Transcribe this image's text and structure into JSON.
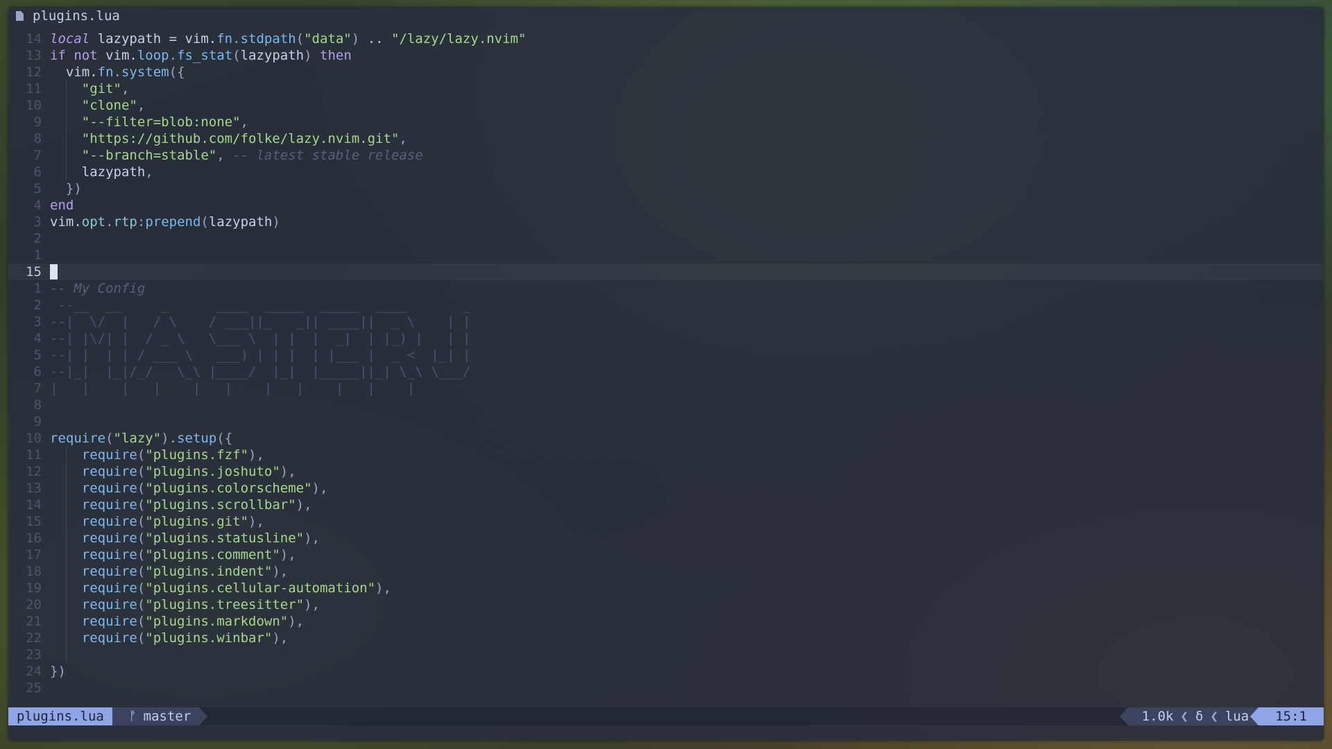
{
  "winbar": {
    "icon": "file-icon",
    "filename": "plugins.lua"
  },
  "lines": [
    {
      "n": "14",
      "t": [
        [
          "kwi",
          "local"
        ],
        [
          "id",
          " lazypath = vim."
        ],
        [
          "fn",
          "fn"
        ],
        [
          "pun",
          "."
        ],
        [
          "fn",
          "stdpath"
        ],
        [
          "pun",
          "("
        ],
        [
          "str",
          "\"data\""
        ],
        [
          "pun",
          ") "
        ],
        [
          "id",
          ".."
        ],
        [
          "str",
          " \"/lazy/lazy.nvim\""
        ]
      ]
    },
    {
      "n": "13",
      "t": [
        [
          "kw",
          "if"
        ],
        [
          "kw",
          " not"
        ],
        [
          "id",
          " vim."
        ],
        [
          "fn",
          "loop"
        ],
        [
          "pun",
          "."
        ],
        [
          "fn",
          "fs_stat"
        ],
        [
          "pun",
          "("
        ],
        [
          "id",
          "lazypath"
        ],
        [
          "pun",
          ") "
        ],
        [
          "kw",
          "then"
        ]
      ]
    },
    {
      "n": "12",
      "t": [
        [
          "id",
          "  vim."
        ],
        [
          "fn",
          "fn"
        ],
        [
          "pun",
          "."
        ],
        [
          "fn",
          "system"
        ],
        [
          "pun",
          "({"
        ]
      ]
    },
    {
      "n": "11",
      "t": [
        [
          "id",
          "    "
        ],
        [
          "str",
          "\"git\""
        ],
        [
          "pun",
          ","
        ]
      ],
      "g": 1
    },
    {
      "n": "10",
      "t": [
        [
          "id",
          "    "
        ],
        [
          "str",
          "\"clone\""
        ],
        [
          "pun",
          ","
        ]
      ],
      "g": 1
    },
    {
      "n": "9",
      "t": [
        [
          "id",
          "    "
        ],
        [
          "str",
          "\"--filter=blob:none\""
        ],
        [
          "pun",
          ","
        ]
      ],
      "g": 1
    },
    {
      "n": "8",
      "t": [
        [
          "id",
          "    "
        ],
        [
          "str",
          "\"https://github.com/folke/lazy.nvim.git\""
        ],
        [
          "pun",
          ","
        ]
      ],
      "g": 1
    },
    {
      "n": "7",
      "t": [
        [
          "id",
          "    "
        ],
        [
          "str",
          "\"--branch=stable\""
        ],
        [
          "pun",
          ", "
        ],
        [
          "cmt",
          "-- latest stable release"
        ]
      ],
      "g": 1
    },
    {
      "n": "6",
      "t": [
        [
          "id",
          "    lazypath"
        ],
        [
          "pun",
          ","
        ]
      ],
      "g": 1
    },
    {
      "n": "5",
      "t": [
        [
          "pun",
          "  })"
        ]
      ]
    },
    {
      "n": "4",
      "t": [
        [
          "kw",
          "end"
        ]
      ]
    },
    {
      "n": "3",
      "t": [
        [
          "id",
          "vim."
        ],
        [
          "prop",
          "opt"
        ],
        [
          "pun",
          "."
        ],
        [
          "prop",
          "rtp"
        ],
        [
          "pun",
          ":"
        ],
        [
          "fn",
          "prepend"
        ],
        [
          "pun",
          "("
        ],
        [
          "id",
          "lazypath"
        ],
        [
          "pun",
          ")"
        ]
      ]
    },
    {
      "n": "2",
      "t": []
    },
    {
      "n": "1",
      "t": []
    },
    {
      "n": "15",
      "t": [],
      "cur": 1
    },
    {
      "n": "1",
      "t": [
        [
          "cmt",
          "-- My Config"
        ]
      ]
    },
    {
      "n": "2",
      "t": [
        [
          "art",
          " --__  __     _      ____  _____  _____  ____       _"
        ]
      ]
    },
    {
      "n": "3",
      "t": [
        [
          "art",
          "--|  \\/  |   / \\    / ___||_   _|| ____||  _ \\    | |"
        ]
      ]
    },
    {
      "n": "4",
      "t": [
        [
          "art",
          "--| |\\/| |  / _ \\   \\___ \\  | |  |  _|  | |_) |   | |"
        ]
      ]
    },
    {
      "n": "5",
      "t": [
        [
          "art",
          "--| |  | | / ___ \\   ___) | | |  | |___ |  _ <  |_| |"
        ]
      ]
    },
    {
      "n": "6",
      "t": [
        [
          "art",
          "--|_|  |_|/_/   \\_\\ |____/  |_|  |_____||_| \\_\\ \\___/"
        ]
      ]
    },
    {
      "n": "7",
      "t": [
        [
          "art",
          "|   |    |   |    |   |    |   |    |   |    |"
        ]
      ]
    },
    {
      "n": "8",
      "t": []
    },
    {
      "n": "9",
      "t": []
    },
    {
      "n": "10",
      "t": [
        [
          "fn",
          "require"
        ],
        [
          "pun",
          "("
        ],
        [
          "str",
          "\"lazy\""
        ],
        [
          "pun",
          ")."
        ],
        [
          "fn",
          "setup"
        ],
        [
          "pun",
          "({"
        ]
      ]
    },
    {
      "n": "11",
      "t": [
        [
          "id",
          "    "
        ],
        [
          "fn",
          "require"
        ],
        [
          "pun",
          "("
        ],
        [
          "str",
          "\"plugins.fzf\""
        ],
        [
          "pun",
          "),"
        ]
      ],
      "g": 1
    },
    {
      "n": "12",
      "t": [
        [
          "id",
          "    "
        ],
        [
          "fn",
          "require"
        ],
        [
          "pun",
          "("
        ],
        [
          "str",
          "\"plugins.joshuto\""
        ],
        [
          "pun",
          "),"
        ]
      ],
      "g": 1
    },
    {
      "n": "13",
      "t": [
        [
          "id",
          "    "
        ],
        [
          "fn",
          "require"
        ],
        [
          "pun",
          "("
        ],
        [
          "str",
          "\"plugins.colorscheme\""
        ],
        [
          "pun",
          "),"
        ]
      ],
      "g": 1
    },
    {
      "n": "14",
      "t": [
        [
          "id",
          "    "
        ],
        [
          "fn",
          "require"
        ],
        [
          "pun",
          "("
        ],
        [
          "str",
          "\"plugins.scrollbar\""
        ],
        [
          "pun",
          "),"
        ]
      ],
      "g": 1
    },
    {
      "n": "15",
      "t": [
        [
          "id",
          "    "
        ],
        [
          "fn",
          "require"
        ],
        [
          "pun",
          "("
        ],
        [
          "str",
          "\"plugins.git\""
        ],
        [
          "pun",
          "),"
        ]
      ],
      "g": 1
    },
    {
      "n": "16",
      "t": [
        [
          "id",
          "    "
        ],
        [
          "fn",
          "require"
        ],
        [
          "pun",
          "("
        ],
        [
          "str",
          "\"plugins.statusline\""
        ],
        [
          "pun",
          "),"
        ]
      ],
      "g": 1
    },
    {
      "n": "17",
      "t": [
        [
          "id",
          "    "
        ],
        [
          "fn",
          "require"
        ],
        [
          "pun",
          "("
        ],
        [
          "str",
          "\"plugins.comment\""
        ],
        [
          "pun",
          "),"
        ]
      ],
      "g": 1
    },
    {
      "n": "18",
      "t": [
        [
          "id",
          "    "
        ],
        [
          "fn",
          "require"
        ],
        [
          "pun",
          "("
        ],
        [
          "str",
          "\"plugins.indent\""
        ],
        [
          "pun",
          "),"
        ]
      ],
      "g": 1
    },
    {
      "n": "19",
      "t": [
        [
          "id",
          "    "
        ],
        [
          "fn",
          "require"
        ],
        [
          "pun",
          "("
        ],
        [
          "str",
          "\"plugins.cellular-automation\""
        ],
        [
          "pun",
          "),"
        ]
      ],
      "g": 1
    },
    {
      "n": "20",
      "t": [
        [
          "id",
          "    "
        ],
        [
          "fn",
          "require"
        ],
        [
          "pun",
          "("
        ],
        [
          "str",
          "\"plugins.treesitter\""
        ],
        [
          "pun",
          "),"
        ]
      ],
      "g": 1
    },
    {
      "n": "21",
      "t": [
        [
          "id",
          "    "
        ],
        [
          "fn",
          "require"
        ],
        [
          "pun",
          "("
        ],
        [
          "str",
          "\"plugins.markdown\""
        ],
        [
          "pun",
          "),"
        ]
      ],
      "g": 1
    },
    {
      "n": "22",
      "t": [
        [
          "id",
          "    "
        ],
        [
          "fn",
          "require"
        ],
        [
          "pun",
          "("
        ],
        [
          "str",
          "\"plugins.winbar\""
        ],
        [
          "pun",
          "),"
        ]
      ],
      "g": 1
    },
    {
      "n": "23",
      "t": [],
      "g": 1
    },
    {
      "n": "24",
      "t": [
        [
          "pun",
          "})"
        ]
      ]
    },
    {
      "n": "25",
      "t": []
    }
  ],
  "statusline": {
    "filename": "plugins.lua",
    "branch_icon": "git-branch-icon",
    "branch": "master",
    "filesize": "1.0k",
    "diff_icon": "δ",
    "filetype": "lua",
    "position": "15:1"
  }
}
